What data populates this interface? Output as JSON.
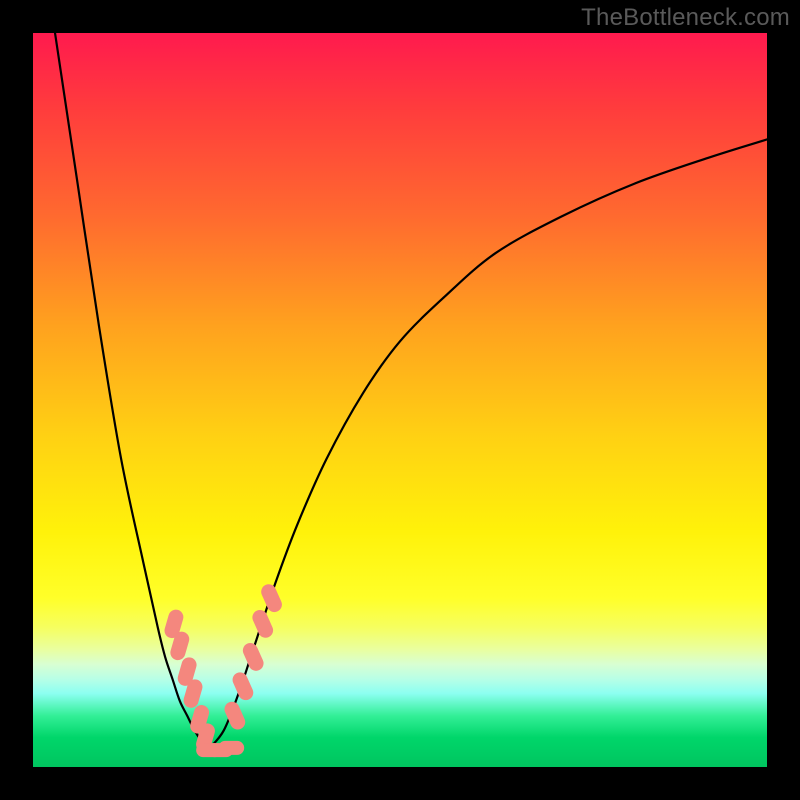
{
  "watermark": "TheBottleneck.com",
  "chart_data": {
    "type": "line",
    "title": "",
    "xlabel": "",
    "ylabel": "",
    "xlim": [
      0,
      100
    ],
    "ylim": [
      0,
      100
    ],
    "grid": false,
    "axes_visible": false,
    "background": "vertical-gradient-red-yellow-green",
    "series": [
      {
        "name": "left-branch",
        "x": [
          3,
          6,
          9,
          12,
          15,
          17,
          18,
          19,
          20,
          21,
          22,
          23,
          24
        ],
        "values": [
          100,
          80,
          60,
          42,
          28,
          19,
          15,
          12,
          9,
          7,
          5,
          3.5,
          2.5
        ]
      },
      {
        "name": "right-branch",
        "x": [
          24,
          26,
          28,
          30,
          33,
          36,
          40,
          45,
          50,
          56,
          63,
          72,
          82,
          92,
          100
        ],
        "values": [
          2.5,
          5,
          10,
          16,
          25,
          33,
          42,
          51,
          58,
          64,
          70,
          75,
          79.5,
          83,
          85.5
        ]
      }
    ],
    "markers": {
      "shape": "rounded-rect",
      "color": "#f4877e",
      "left_branch_points": [
        {
          "x": 19.2,
          "y": 19.5
        },
        {
          "x": 20.0,
          "y": 16.5
        },
        {
          "x": 21.0,
          "y": 13.0
        },
        {
          "x": 21.8,
          "y": 10.0
        },
        {
          "x": 22.7,
          "y": 6.5
        },
        {
          "x": 23.5,
          "y": 4.0
        }
      ],
      "right_branch_points": [
        {
          "x": 27.5,
          "y": 7.0
        },
        {
          "x": 28.6,
          "y": 11.0
        },
        {
          "x": 30.0,
          "y": 15.0
        },
        {
          "x": 31.3,
          "y": 19.5
        },
        {
          "x": 32.5,
          "y": 23.0
        }
      ],
      "bottom_points": [
        {
          "x": 24.0,
          "y": 2.3
        },
        {
          "x": 25.5,
          "y": 2.3
        },
        {
          "x": 27.0,
          "y": 2.6
        }
      ]
    }
  }
}
